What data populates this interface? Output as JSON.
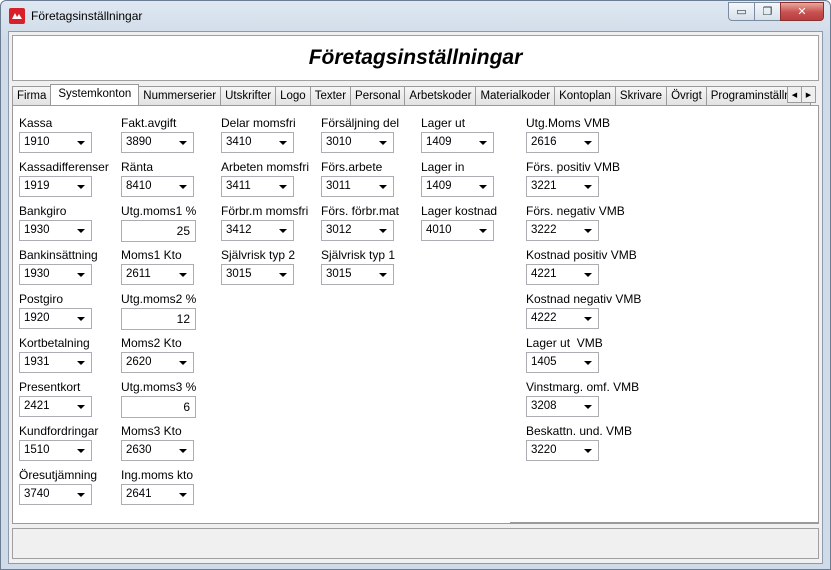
{
  "window": {
    "title": "Företagsinställningar",
    "minimize_glyph": "▭",
    "restore_glyph": "❐",
    "close_glyph": "✕"
  },
  "header": {
    "title": "Företagsinställningar"
  },
  "tabs": [
    "Firma",
    "Systemkonton",
    "Nummerserier",
    "Utskrifter",
    "Logo",
    "Texter",
    "Personal",
    "Arbetskoder",
    "Materialkoder",
    "Kontoplan",
    "Skrivare",
    "Övrigt",
    "Programinställning"
  ],
  "active_tab": "Systemkonton",
  "tab_scroll": {
    "left": "◀",
    "right": "▶"
  },
  "fields": {
    "kassa": {
      "label": "Kassa",
      "value": "1910"
    },
    "kassadifferenser": {
      "label": "Kassadifferenser",
      "value": "1919"
    },
    "bankgiro": {
      "label": "Bankgiro",
      "value": "1930"
    },
    "bankinsattning": {
      "label": "Bankinsättning",
      "value": "1930"
    },
    "postgiro": {
      "label": "Postgiro",
      "value": "1920"
    },
    "kortbetalning": {
      "label": "Kortbetalning",
      "value": "1931"
    },
    "presentkort": {
      "label": "Presentkort",
      "value": "2421"
    },
    "kundfordringar": {
      "label": "Kundfordringar",
      "value": "1510"
    },
    "oresutjamning": {
      "label": "Öresutjämning",
      "value": "3740"
    },
    "fakt_avgift": {
      "label": "Fakt.avgift",
      "value": "3890"
    },
    "ranta": {
      "label": "Ränta",
      "value": "8410"
    },
    "utg_moms1_pct": {
      "label": "Utg.moms1 %",
      "value": "25"
    },
    "moms1_kto": {
      "label": "Moms1 Kto",
      "value": "2611"
    },
    "utg_moms2_pct": {
      "label": "Utg.moms2 %",
      "value": "12"
    },
    "moms2_kto": {
      "label": "Moms2 Kto",
      "value": "2620"
    },
    "utg_moms3_pct": {
      "label": "Utg.moms3 %",
      "value": "6"
    },
    "moms3_kto": {
      "label": "Moms3 Kto",
      "value": "2630"
    },
    "ing_moms_kto": {
      "label": "Ing.moms kto",
      "value": "2641"
    },
    "delar_momsfri": {
      "label": "Delar momsfri",
      "value": "3410"
    },
    "arbeten_momsfri": {
      "label": "Arbeten momsfri",
      "value": "3411"
    },
    "forbr_m_momsfri": {
      "label": "Förbr.m momsfri",
      "value": "3412"
    },
    "sjalvrisk_typ2": {
      "label": "Självrisk typ 2",
      "value": "3015"
    },
    "forsaljning_del": {
      "label": "Försäljning del",
      "value": "3010"
    },
    "fors_arbete": {
      "label": "Förs.arbete",
      "value": "3011"
    },
    "fors_forbr_mat": {
      "label": "Förs. förbr.mat",
      "value": "3012"
    },
    "sjalvrisk_typ1": {
      "label": "Självrisk typ 1",
      "value": "3015"
    },
    "lager_ut": {
      "label": "Lager ut",
      "value": "1409"
    },
    "lager_in": {
      "label": "Lager in",
      "value": "1409"
    },
    "lager_kostnad": {
      "label": "Lager kostnad",
      "value": "4010"
    },
    "utg_moms_vmb": {
      "label": "Utg.Moms VMB",
      "value": "2616"
    },
    "fors_positiv_vmb": {
      "label": "Förs. positiv VMB",
      "value": "3221"
    },
    "fors_negativ_vmb": {
      "label": "Förs. negativ VMB",
      "value": "3222"
    },
    "kostnad_positiv_vmb": {
      "label": "Kostnad positiv VMB",
      "value": "4221"
    },
    "kostnad_negativ_vmb": {
      "label": "Kostnad negativ VMB",
      "value": "4222"
    },
    "lager_ut_vmb": {
      "label": "Lager ut  VMB",
      "value": "1405"
    },
    "vinstmarg_omf_vmb": {
      "label": "Vinstmarg. omf. VMB",
      "value": "3208"
    },
    "beskattn_und_vmb": {
      "label": "Beskattn. und. VMB",
      "value": "3220"
    }
  },
  "icons": {
    "app": "company-settings-icon",
    "dropdown": "chevron-down-icon"
  },
  "colors": {
    "app_icon_red": "#d8202a",
    "close_button": "#c75050"
  }
}
